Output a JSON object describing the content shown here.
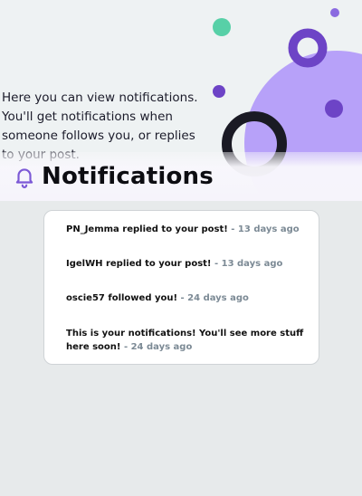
{
  "intro": {
    "text": "Here you can view notifications. You'll get notifications when someone follows you, or replies to your post."
  },
  "header": {
    "title": "Notifications",
    "icon": "bell-icon",
    "accent_color": "#7c59d6"
  },
  "decor": {
    "colors": {
      "lavender": "#b7a1f9",
      "purple": "#6d44c6",
      "green": "#57d0a7",
      "dark_ring": "#1a1a24",
      "light_ring": "#e1e3e5"
    }
  },
  "notifications": [
    {
      "message": "PN_Jemma replied to your post!",
      "separator": " - ",
      "time": "13 days ago"
    },
    {
      "message": "IgelWH replied to your post!",
      "separator": " - ",
      "time": "13 days ago"
    },
    {
      "message": "oscie57 followed you!",
      "separator": " - ",
      "time": "24 days ago"
    },
    {
      "message": "This is your notifications! You'll see more stuff here soon!",
      "separator": " - ",
      "time": "24 days ago"
    }
  ]
}
